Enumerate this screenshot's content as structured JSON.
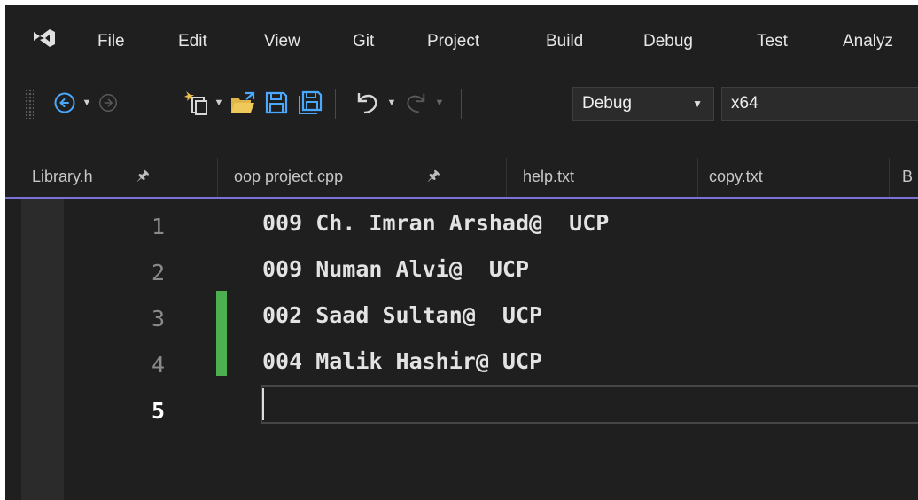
{
  "menu": {
    "items": [
      {
        "label": "File"
      },
      {
        "label": "Edit"
      },
      {
        "label": "View"
      },
      {
        "label": "Git"
      },
      {
        "label": "Project"
      },
      {
        "label": "Build"
      },
      {
        "label": "Debug"
      },
      {
        "label": "Test"
      },
      {
        "label": "Analyz"
      }
    ]
  },
  "toolbar": {
    "icons": {
      "back": "navigate-back-icon",
      "forward": "navigate-forward-icon",
      "new_item": "new-project-icon",
      "open": "open-folder-icon",
      "save": "save-icon",
      "save_all": "save-all-icon",
      "undo": "undo-icon",
      "redo": "redo-icon"
    },
    "configuration": "Debug",
    "platform": "x64"
  },
  "tabs": [
    {
      "label": "Library.h",
      "pinned": true
    },
    {
      "label": "oop project.cpp",
      "pinned": true
    },
    {
      "label": "help.txt",
      "pinned": false
    },
    {
      "label": "copy.txt",
      "pinned": false
    },
    {
      "label": "B",
      "pinned": false
    }
  ],
  "editor": {
    "lines": [
      {
        "number": "1",
        "text": "009 Ch. Imran Arshad@  UCP"
      },
      {
        "number": "2",
        "text": "009 Numan Alvi@  UCP"
      },
      {
        "number": "3",
        "text": "002 Saad Sultan@  UCP"
      },
      {
        "number": "4",
        "text": "004 Malik Hashir@ UCP"
      },
      {
        "number": "5",
        "text": ""
      }
    ],
    "current_line": "5",
    "changed_lines": [
      "3",
      "4"
    ],
    "colors": {
      "background": "#1f1f1f",
      "change_marker": "#4caf50",
      "tab_accent": "#7b72d6"
    }
  }
}
